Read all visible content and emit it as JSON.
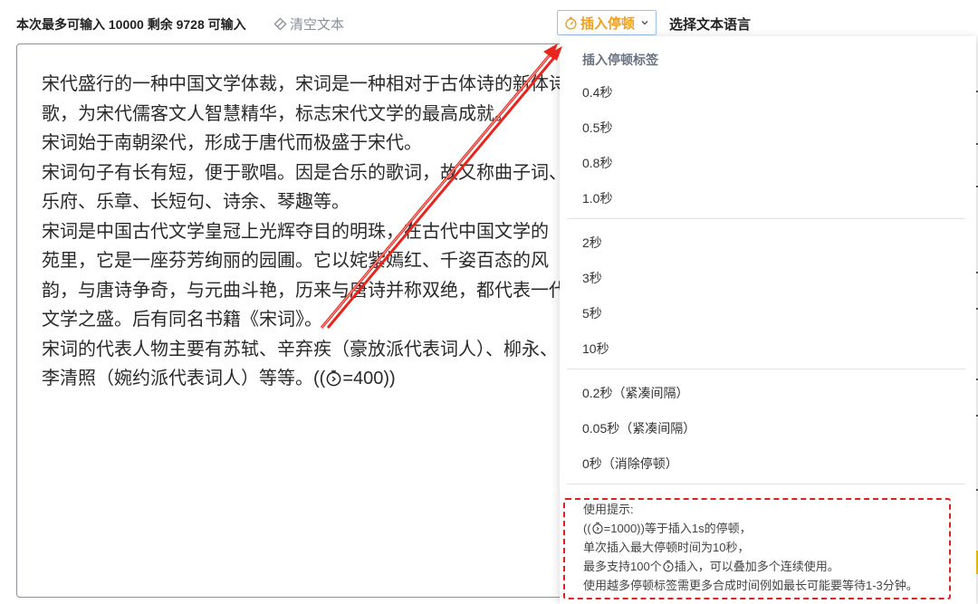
{
  "toolbar": {
    "counter_text": "本次最多可输入 10000 剩余 9728 可输入",
    "clear_label": "清空文本",
    "insert_pause_label": "插入停顿",
    "select_language_label": "选择文本语言"
  },
  "editor": {
    "lines": [
      "宋代盛行的一种中国文学体裁，宋词是一种相对于古体诗的新体诗",
      "歌，为宋代儒客文人智慧精华，标志宋代文学的最高成就。",
      "宋词始于南朝梁代，形成于唐代而极盛于宋代。",
      "宋词句子有长有短，便于歌唱。因是合乐的歌词，故又称曲子词、",
      "乐府、乐章、长短句、诗余、琴趣等。",
      "宋词是中国古代文学皇冠上光辉夺目的明珠，在古代中国文学的",
      "苑里，它是一座芬芳绚丽的园圃。它以姹紫嫣红、千姿百态的风",
      "韵，与唐诗争奇，与元曲斗艳，历来与唐诗并称双绝，都代表一代",
      "文学之盛。后有同名书籍《宋词》。",
      "宋词的代表人物主要有苏轼、辛弃疾（豪放派代表词人）、柳永、",
      "李清照（婉约派代表词人）等等。(("
    ],
    "last_line_suffix": "=400))"
  },
  "dropdown": {
    "header": "插入停顿标签",
    "group1": [
      "0.4秒",
      "0.5秒",
      "0.8秒",
      "1.0秒"
    ],
    "group2": [
      "2秒",
      "3秒",
      "5秒",
      "10秒"
    ],
    "group3": [
      "0.2秒（紧凑间隔）",
      "0.05秒（紧凑间隔）",
      "0秒（消除停顿）"
    ],
    "tips": {
      "title": "使用提示:",
      "line1_prefix": "((",
      "line1_suffix": "=1000))等于插入1s的停顿，",
      "line2": "单次插入最大停顿时间为10秒，",
      "line3_prefix": "最多支持100个",
      "line3_suffix": "插入，可以叠加多个连续使用。",
      "line4": "使用越多停顿标签需更多合成时间例如最长可能要等待1-3分钟。"
    }
  },
  "colors": {
    "accent_orange": "#f0a020",
    "annotation_red": "#e02020",
    "button_border": "#9cc1ee"
  },
  "icons": {
    "clear": "diamond-eraser-icon",
    "pause": "stopwatch-icon",
    "dropdown": "chevron-down-icon"
  }
}
